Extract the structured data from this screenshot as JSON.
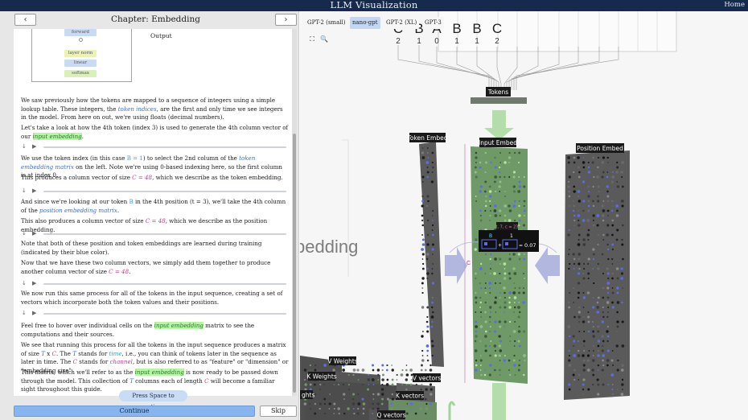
{
  "app": {
    "title": "LLM Visualization",
    "home_label": "Home"
  },
  "chapter": {
    "prev_icon": "‹",
    "next_icon": "›",
    "title": "Chapter: Embedding"
  },
  "diagram": {
    "boxes": [
      "forward",
      "layer norm",
      "linear",
      "softmax"
    ],
    "output_label": "Output"
  },
  "paragraphs": {
    "p1": {
      "a": "We saw previously how the tokens are mapped to a sequence of integers using a simple lookup table. These integers, the ",
      "b": "token indices",
      "c": ", are the first and only time we see integers in the model. From here on out, we're using floats (decimal numbers)."
    },
    "p2": {
      "a": "Let's take a look at how the 4th token (index 3) is used to generate the 4th column vector of our ",
      "b": "input embedding",
      "c": "."
    },
    "p3": {
      "a": "We use the token index (in this case ",
      "b": "B = 1",
      "c": ") to select the 2nd column of the ",
      "d": "token embedding matrix",
      "e": " on the left. Note we're using 0-based indexing here, so the first column is at index 0."
    },
    "p4": {
      "a": "This produces a column vector of size ",
      "b": "C = 48",
      "c": ", which we describe as the token embedding."
    },
    "p5": {
      "a": "And since we're looking at our token ",
      "b": "B",
      "c": " in the 4th position (t = 3), we'll take the 4th column of the ",
      "d": "position embedding matrix",
      "e": "."
    },
    "p6": {
      "a": "This also produces a column vector of size ",
      "b": "C = 48",
      "c": ", which we describe as the position embedding."
    },
    "p7": {
      "a": "Note that both of these position and token embeddings are learned during training (indicated by their blue color)."
    },
    "p8": {
      "a": "Now that we have these two column vectors, we simply add them together to produce another column vector of size ",
      "b": "C = 48",
      "c": "."
    },
    "p9": {
      "a": "We now run this same process for all of the tokens in the input sequence, creating a set of vectors which incorporate both the token values and their positions."
    },
    "p10": {
      "a": "Feel free to hover over individual cells on the ",
      "b": "input embedding",
      "c": " matrix to see the computations and their sources."
    },
    "p11": {
      "a": "We see that running this process for all the tokens in the input sequence produces a matrix of size ",
      "b": "T",
      "c": " x ",
      "d": "C",
      "e": ". The ",
      "f": "T",
      "g": " stands for ",
      "h": "time",
      "i": ", i.e., you can think of tokens later in the sequence as later in time. The ",
      "j": "C",
      "k": " stands for ",
      "l": "channel",
      "m": ", but is also referred to as \"feature\" or \"dimension\" or \"embedding size\"."
    },
    "p12": {
      "a": "This matrix, which we'll refer to as the ",
      "b": "input embedding",
      "c": " is now ready to be passed down through the model. This collection of ",
      "d": "T",
      "e": " columns each of length ",
      "f": "C",
      "g": " will become a familiar sight throughout this guide."
    }
  },
  "player": {
    "back_icon": "↓",
    "play_icon": "▶"
  },
  "footer": {
    "press_space": "Press Space to continue",
    "continue_label": "Continue",
    "skip_label": "Skip"
  },
  "viz": {
    "model_tabs": [
      "GPT-2 (small)",
      "nano-gpt",
      "GPT-2 (XL)",
      "GPT-3"
    ],
    "active_model": "nano-gpt",
    "tool_icons": {
      "fit": "⛶",
      "search": "🔍"
    },
    "tokens": [
      {
        "char": "C",
        "index": "2"
      },
      {
        "char": "B",
        "index": "1"
      },
      {
        "char": "A",
        "index": "0"
      },
      {
        "char": "B",
        "index": "1"
      },
      {
        "char": "B",
        "index": "1"
      },
      {
        "char": "C",
        "index": "2"
      }
    ],
    "labels": {
      "tokens": "Tokens",
      "token_embed": "Token Embed",
      "input_embed": "Input Embed",
      "position_embed": "Position Embed",
      "embedding_watermark": "bedding",
      "v_weights": "V Weights",
      "k_weights": "K Weights",
      "v_vectors": "V vectors",
      "k_vectors": "K vectors",
      "q_vectors": "Q vectors",
      "weights_partial": "ghts",
      "dim_c": "C"
    },
    "tooltip": {
      "header": "t, 7, c = 23",
      "b_label": "B",
      "t_label": "1",
      "value": "0.07"
    },
    "colors": {
      "accent": "#86b5ef",
      "nav_bar": "#152a4d",
      "input_embed": "#6f9a68",
      "embedding_blue": "#5a6ee0",
      "highlight_green": "#b8f5a4"
    }
  }
}
